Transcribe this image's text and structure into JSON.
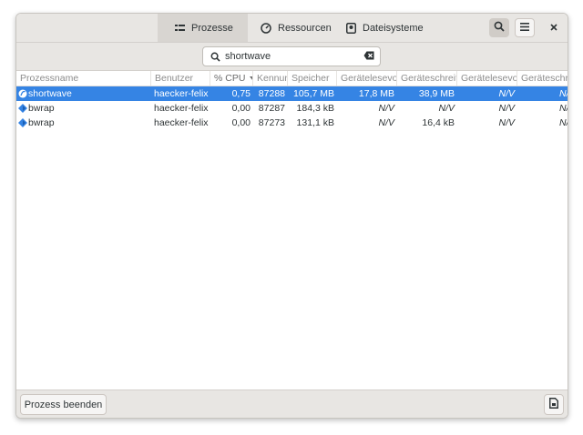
{
  "headerbar": {
    "tabs": [
      {
        "label": "Prozesse",
        "icon": "process-list-icon",
        "active": true
      },
      {
        "label": "Ressourcen",
        "icon": "gauge-icon",
        "active": false
      },
      {
        "label": "Dateisysteme",
        "icon": "disk-icon",
        "active": false
      }
    ],
    "buttons": [
      "search-icon",
      "menu-icon",
      "close-icon"
    ]
  },
  "search": {
    "value": "shortwave",
    "placeholder": ""
  },
  "table": {
    "columns": [
      "Prozessname",
      "Benutzer",
      "% CPU",
      "Kennun",
      "Speicher",
      "Gerätelesevor",
      "Geräteschreit",
      "Gerätelesevor",
      "Geräteschre"
    ],
    "sorted_column": "% CPU",
    "rows": [
      {
        "name": "shortwave",
        "user": "haecker-felix",
        "cpu": "0,75",
        "id": "87288",
        "mem": "105,7 MB",
        "read": "17,8 MB",
        "write": "38,9 MB",
        "read2": "N/V",
        "write2": "N/",
        "selected": true
      },
      {
        "name": "bwrap",
        "user": "haecker-felix",
        "cpu": "0,00",
        "id": "87287",
        "mem": "184,3 kB",
        "read": "N/V",
        "write": "N/V",
        "read2": "N/V",
        "write2": "N/",
        "selected": false
      },
      {
        "name": "bwrap",
        "user": "haecker-felix",
        "cpu": "0,00",
        "id": "87273",
        "mem": "131,1 kB",
        "read": "N/V",
        "write": "16,4 kB",
        "read2": "N/V",
        "write2": "N/",
        "selected": false
      }
    ]
  },
  "bottombar": {
    "end_process_label": "Prozess beenden",
    "details_icon": "document-properties-icon"
  },
  "colors": {
    "accent": "#3584e4",
    "header_bg": "#e8e6e3",
    "text": "#2e3436"
  }
}
